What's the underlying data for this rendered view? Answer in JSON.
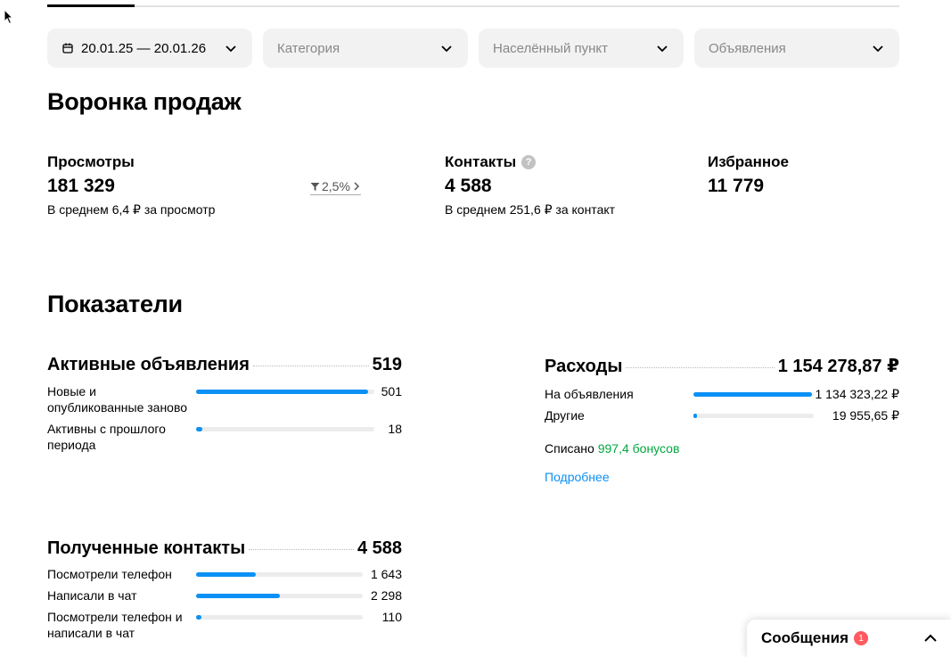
{
  "filters": {
    "date": "20.01.25 — 20.01.26",
    "category": "Категория",
    "locality": "Населённый пункт",
    "ads": "Объявления"
  },
  "funnel": {
    "title": "Воронка продаж",
    "views": {
      "label": "Просмотры",
      "value": "181 329",
      "sub": "В среднем 6,4 ₽ за просмотр"
    },
    "conversion": "2,5%",
    "contacts": {
      "label": "Контакты",
      "help": "?",
      "value": "4 588",
      "sub": "В среднем 251,6 ₽ за контакт"
    },
    "favorites": {
      "label": "Избранное",
      "value": "11 779"
    }
  },
  "indicators": {
    "title": "Показатели",
    "active_ads": {
      "title": "Активные объявления",
      "total": "519",
      "rows": [
        {
          "label": "Новые и опубликованные заново",
          "value": "501",
          "share": 0.965
        },
        {
          "label": "Активны с прошлого периода",
          "value": "18",
          "share": 0.035
        }
      ]
    },
    "expenses": {
      "title": "Расходы",
      "total": "1 154 278,87 ₽",
      "rows": [
        {
          "label": "На объявления",
          "value": "1 134 323,22 ₽",
          "share": 0.983
        },
        {
          "label": "Другие",
          "value": "19 955,65 ₽",
          "share": 0.017
        }
      ],
      "spent_prefix": "Списано",
      "spent_bonus": "997,4 бонусов",
      "more_link": "Подробнее"
    },
    "contacts": {
      "title": "Полученные контакты",
      "total": "4 588",
      "rows": [
        {
          "label": "Посмотрели телефон",
          "value": "1 643",
          "share": 0.358
        },
        {
          "label": "Написали в чат",
          "value": "2 298",
          "share": 0.501
        },
        {
          "label": "Посмотрели телефон и написали в чат",
          "value": "110",
          "share": 0.024
        }
      ]
    }
  },
  "messages": {
    "label": "Сообщения",
    "count": "1"
  },
  "colors": {
    "accent": "#0b91f5",
    "green": "#02a83f",
    "badge": "#ff5a5f"
  }
}
